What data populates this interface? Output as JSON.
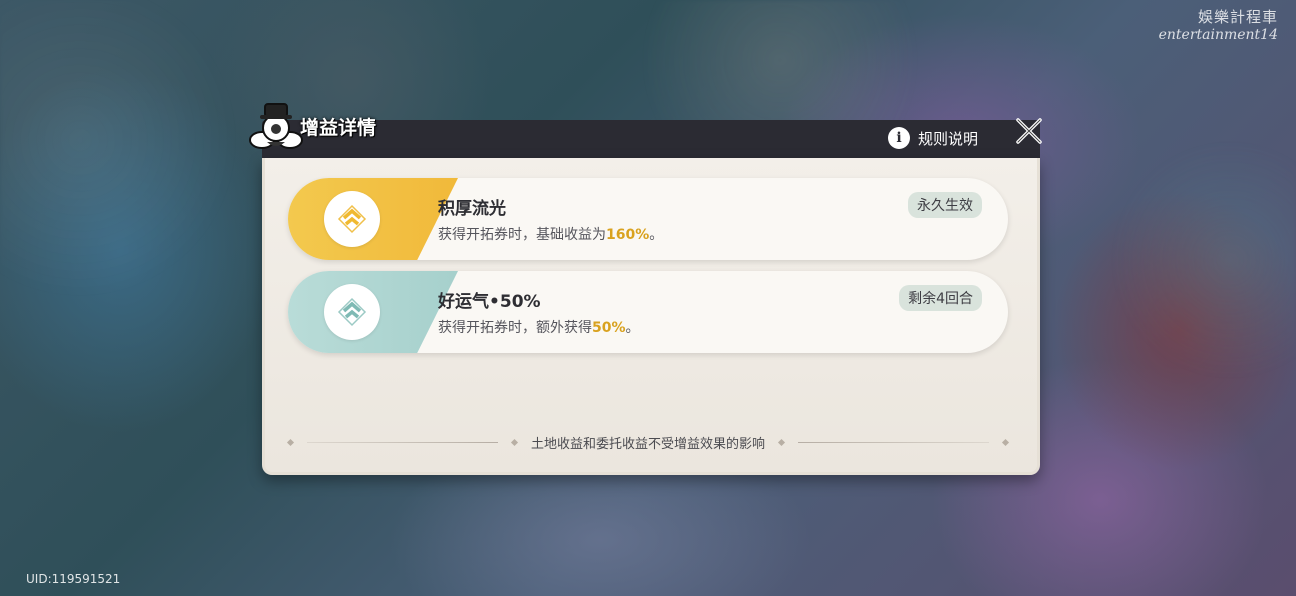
{
  "watermark": {
    "line1": "娛樂計程車",
    "line2": "entertainment14"
  },
  "uid": "UID:119591521",
  "panel": {
    "title": "增益详情",
    "rules_label": "规则说明",
    "footer_note": "土地收益和委托收益不受增益效果的影响"
  },
  "buffs": [
    {
      "name": "积厚流光",
      "desc_prefix": "获得开拓券时，基础收益为",
      "desc_value": "160%",
      "desc_suffix": "。",
      "badge": "永久生效",
      "accent_color": "#f3c94e",
      "icon": "chevron-up-gold-icon"
    },
    {
      "name": "好运气•50%",
      "desc_prefix": "获得开拓券时，额外获得",
      "desc_value": "50%",
      "desc_suffix": "。",
      "badge": "剩余4回合",
      "accent_color": "#b9dcd8",
      "icon": "chevron-up-teal-icon"
    }
  ]
}
